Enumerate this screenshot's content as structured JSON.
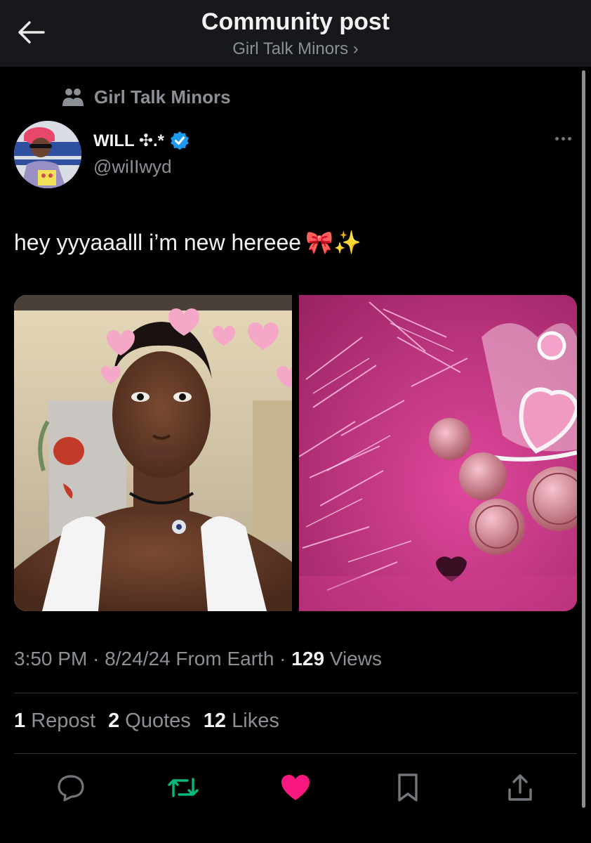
{
  "header": {
    "title": "Community post",
    "subtitle": "Girl Talk Minors ›",
    "back_icon": "arrow-left-icon"
  },
  "community": {
    "name": "Girl Talk Minors",
    "icon": "people-icon"
  },
  "author": {
    "display_name": "WILL ✣.*",
    "handle": "@wiIIwyd",
    "verified": true,
    "verified_color": "#1d9bf0"
  },
  "post": {
    "text": "hey yyyaaalll i’m new hereee",
    "emoji": "🎀✨"
  },
  "meta": {
    "time": "3:50 PM",
    "sep1": " · ",
    "date": "8/24/24",
    "source": " From Earth",
    "sep2": " · ",
    "views_count": "129",
    "views_label": " Views"
  },
  "stats": {
    "reposts_count": "1",
    "reposts_label": " Repost",
    "quotes_count": "2",
    "quotes_label": " Quotes",
    "likes_count": "12",
    "likes_label": " Likes"
  },
  "actions": [
    {
      "icon": "reply-icon",
      "color": "#71767b"
    },
    {
      "icon": "repost-icon",
      "color": "#00ba7c"
    },
    {
      "icon": "heart-icon",
      "color": "#f91880"
    },
    {
      "icon": "bookmark-icon",
      "color": "#71767b"
    },
    {
      "icon": "share-icon",
      "color": "#71767b"
    }
  ],
  "colors": {
    "background": "#000000",
    "header": "#16181c",
    "muted": "#8b9096",
    "text": "#e7e9ea",
    "repost_active": "#00ba7c",
    "like_active": "#f91880"
  }
}
